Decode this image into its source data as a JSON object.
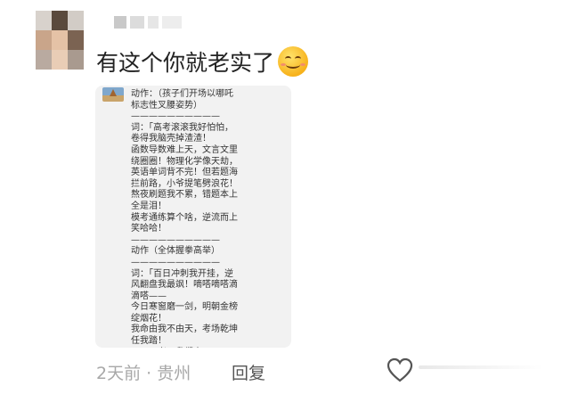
{
  "comment": {
    "text": "有这个你就老实了",
    "emoji": "smiling-face-emoji"
  },
  "image_card": {
    "lines": [
      "动作：（孩子们开场以哪吒",
      "标志性叉腰姿势）",
      "——————————",
      "词：「高考滚滚我好怕怕，",
      "卷得我脑壳掉渣渣！",
      "函数导数难上天，文言文里",
      "绕圈圈！物理化学像天劫，",
      "英语单词背不完！但若题海",
      "拦前路，小爷提笔劈浪花！",
      "熬夜刷题我不累，错题本上",
      "全是泪！",
      "模考通练算个啥，逆流而上",
      "笑哈哈！",
      "——————————",
      "动作（全体握拳高举）",
      "——————————",
      "词：「百日冲刺我开挂，逆",
      "风翻盘我最飒！嘀嗒嘀嗒滴",
      "滴嗒——",
      "今日寒窗磨一剑，明朝金榜",
      "绽烟花！",
      "我命由我不由天，考场乾坤",
      "任我踏！",
      "——万考，我们来了！"
    ]
  },
  "footer": {
    "meta": "2天前 · 贵州",
    "reply": "回复"
  },
  "colors": {
    "text": "#222222",
    "meta": "#a8a8a8",
    "card_bg": "#f2f2f2"
  }
}
